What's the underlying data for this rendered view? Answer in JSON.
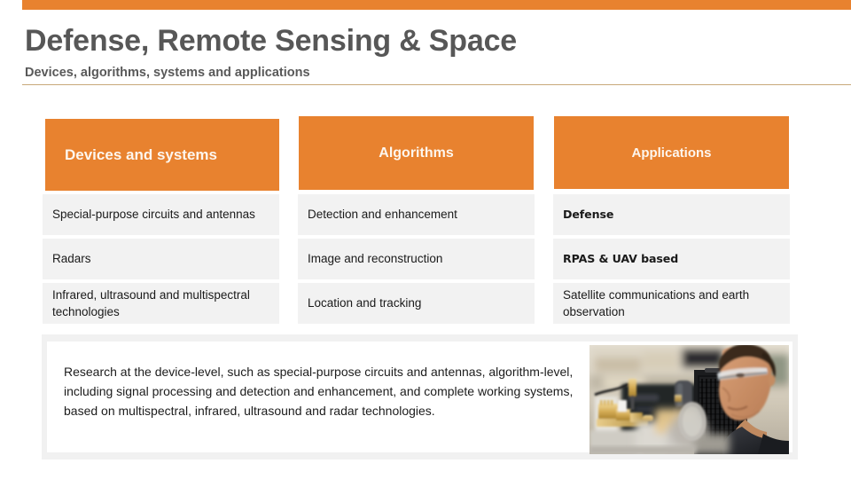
{
  "slide": {
    "title": "Defense, Remote Sensing & Space",
    "subtitle": "Devices, algorithms, systems and applications",
    "accent_color": "#e8822f",
    "rule_color": "#c8a97a",
    "title_color": "#575757",
    "cell_bg_color": "#f2f2f2"
  },
  "table": {
    "headers": [
      "Devices and systems",
      "Algorithms",
      "Applications"
    ],
    "rows": [
      {
        "devices_and_systems": "Special-purpose circuits and antennas",
        "algorithms": "Detection and enhancement",
        "applications": "Defense"
      },
      {
        "devices_and_systems": "Radars",
        "algorithms": "Image and reconstruction",
        "applications": "RPAS & UAV based"
      },
      {
        "devices_and_systems": "Infrared, ultrasound and multispectral technologies",
        "algorithms": "Location and tracking",
        "applications": "Satellite communications and earth observation"
      }
    ]
  },
  "summary": {
    "paragraph": "Research at the device-level, such as special-purpose circuits and antennas, algorithm-level, including signal processing and detection and enhancement, and complete working systems, based on multispectral, infrared, ultrasound and radar technologies."
  },
  "photo": {
    "alt": "Researcher wearing safety glasses working with gold waveguide RF test equipment in a laboratory"
  }
}
